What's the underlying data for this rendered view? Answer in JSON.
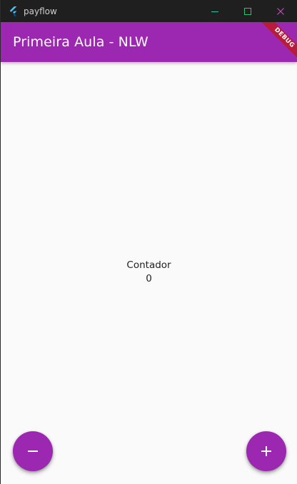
{
  "window": {
    "title": "payflow",
    "icon": "flutter-icon",
    "controls": [
      "minimize-icon",
      "maximize-icon",
      "close-icon"
    ]
  },
  "appbar": {
    "title": "Primeira Aula - NLW",
    "color": "#9c27b0"
  },
  "debug_banner": {
    "label": "DEBUG",
    "color": "#b71c3a"
  },
  "counter": {
    "label": "Contador",
    "value": "0"
  },
  "fabs": {
    "decrement_icon": "minus-icon",
    "increment_icon": "plus-icon"
  }
}
